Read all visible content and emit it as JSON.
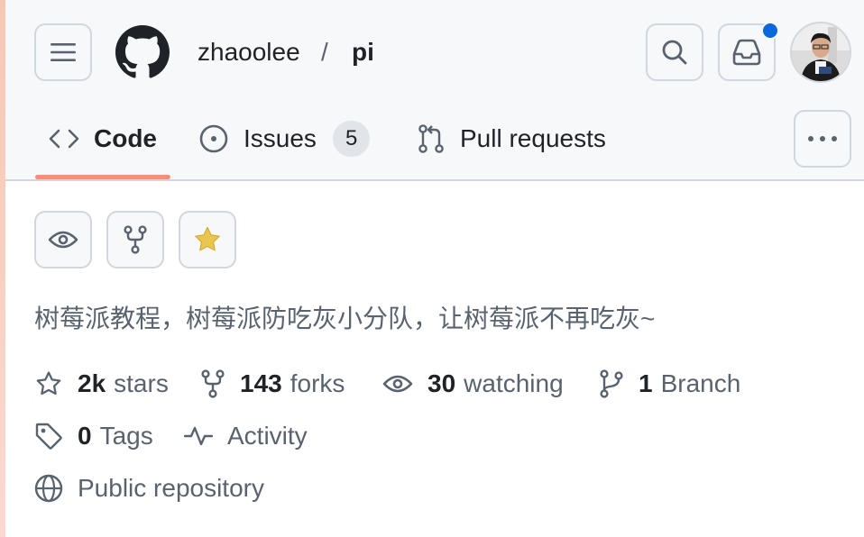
{
  "header": {
    "owner": "zhaoolee",
    "separator": "/",
    "repo": "pi",
    "notification_dot_color": "#0969da"
  },
  "tabs": [
    {
      "label": "Code",
      "icon": "code-icon",
      "selected": true
    },
    {
      "label": "Issues",
      "icon": "issue-opened-icon",
      "counter": "5"
    },
    {
      "label": "Pull requests",
      "icon": "git-pull-request-icon"
    }
  ],
  "actions": {
    "watch_icon": "eye-icon",
    "fork_icon": "repo-forked-icon",
    "star_icon": "star-fill-icon",
    "star_color": "#eac54f"
  },
  "description": "树莓派教程，树莓派防吃灰小分队，让树莓派不再吃灰~",
  "stats": {
    "stars_count": "2k",
    "stars_label": "stars",
    "forks_count": "143",
    "forks_label": "forks",
    "watching_count": "30",
    "watching_label": "watching",
    "branch_count": "1",
    "branch_label": "Branch",
    "tags_count": "0",
    "tags_label": "Tags",
    "activity_label": "Activity",
    "visibility_label": "Public repository"
  },
  "colors": {
    "tab_underline": "#fd8c73",
    "header_bg": "#f6f8fa"
  }
}
